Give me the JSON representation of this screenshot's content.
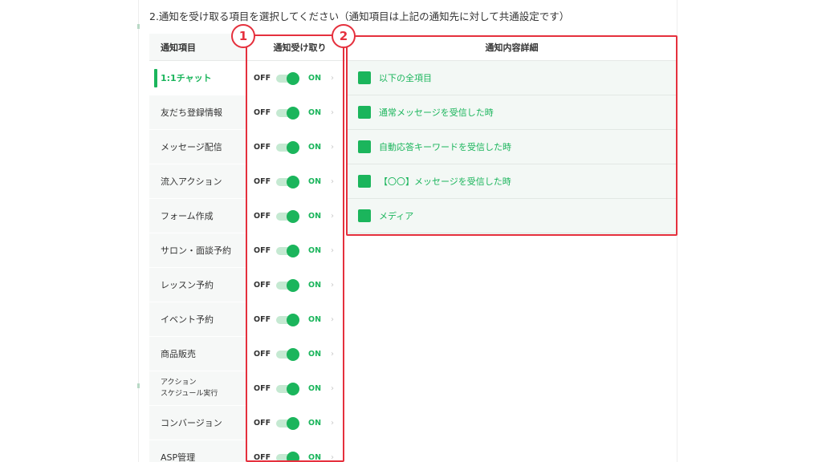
{
  "section_title": "2.通知を受け取る項目を選択してください（通知項目は上記の通知先に対して共通設定です）",
  "columns": {
    "items_header": "通知項目",
    "receive_header": "通知受け取り",
    "detail_header": "通知内容詳細"
  },
  "items": [
    {
      "label": "1:1チャット"
    },
    {
      "label": "友だち登録情報"
    },
    {
      "label": "メッセージ配信"
    },
    {
      "label": "流入アクション"
    },
    {
      "label": "フォーム作成"
    },
    {
      "label": "サロン・面談予約"
    },
    {
      "label": "レッスン予約"
    },
    {
      "label": "イベント予約"
    },
    {
      "label": "商品販売"
    },
    {
      "line1": "アクション",
      "line2": "スケジュール実行"
    },
    {
      "label": "コンバージョン"
    },
    {
      "label": "ASP管理"
    }
  ],
  "toggle": {
    "off_label": "OFF",
    "on_label": "ON",
    "states": [
      "ON",
      "ON",
      "ON",
      "ON",
      "ON",
      "ON",
      "ON",
      "ON",
      "ON",
      "ON",
      "ON",
      "ON"
    ],
    "chevron": "›"
  },
  "details": [
    {
      "label": "以下の全項目",
      "checked": true
    },
    {
      "label": "通常メッセージを受信した時",
      "checked": true
    },
    {
      "label": "自動応答キーワードを受信した時",
      "checked": true
    },
    {
      "label": "【〇〇】メッセージを受信した時",
      "checked": true
    },
    {
      "label": "メディア",
      "checked": true
    }
  ],
  "annotations": {
    "badge_1": "1",
    "badge_2": "2"
  },
  "colors": {
    "accent": "#1bb55c",
    "annotation": "#e5303d"
  }
}
